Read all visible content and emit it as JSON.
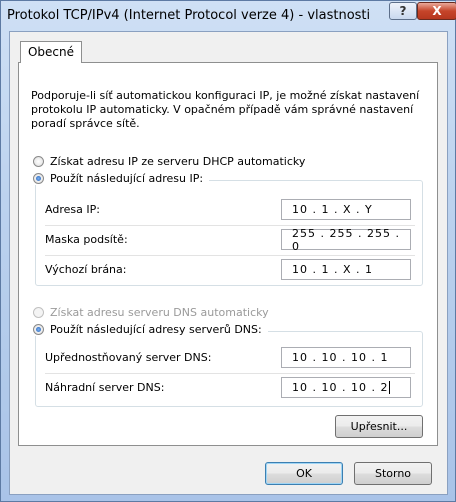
{
  "window": {
    "title": "Protokol TCP/IPv4 (Internet Protocol verze 4) - vlastnosti",
    "help_label": "?",
    "close_label": "X"
  },
  "tabs": [
    {
      "label": "Obecné",
      "active": true
    }
  ],
  "description": "Podporuje-li síť automatickou konfiguraci IP, je možné získat nastavení protokolu IP automaticky. V opačném případě vám správné nastavení poradí správce sítě.",
  "ip_options": {
    "auto_label": "Získat adresu IP ze serveru DHCP automaticky",
    "manual_label": "Použít následující adresu IP:",
    "selected": "manual"
  },
  "ip_fields": [
    {
      "label": "Adresa IP:",
      "value": "10 . 1 . X . Y"
    },
    {
      "label": "Maska podsítě:",
      "value": "255 . 255 . 255 . 0"
    },
    {
      "label": "Výchozí brána:",
      "value": "10 . 1 . X . 1"
    }
  ],
  "dns_options": {
    "auto_label": "Získat adresu serveru DNS automaticky",
    "manual_label": "Použít následující adresy serverů DNS:",
    "selected": "manual"
  },
  "dns_fields": [
    {
      "label": "Upřednostňovaný server DNS:",
      "value": "10 . 10 . 10 . 1"
    },
    {
      "label": "Náhradní server DNS:",
      "value": "10 . 10 . 10 . 2"
    }
  ],
  "buttons": {
    "advanced": "Upřesnit...",
    "ok": "OK",
    "cancel": "Storno"
  },
  "colors": {
    "title_close": "#c6452a",
    "radio_selected": "#1f5fb8"
  }
}
